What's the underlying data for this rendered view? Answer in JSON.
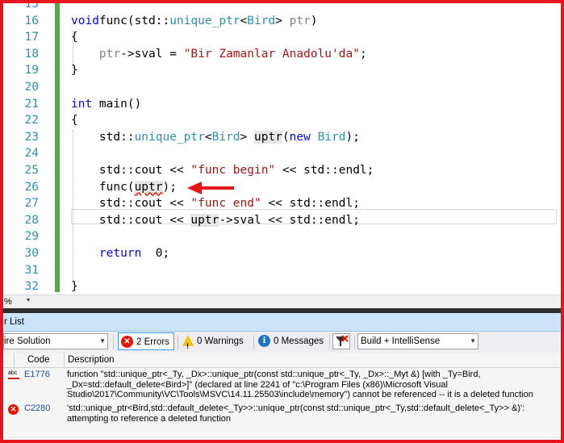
{
  "editor": {
    "lines": [
      {
        "num": "15",
        "tokens": []
      },
      {
        "num": "16",
        "tokens": [
          [
            "kw",
            "void"
          ],
          [
            "",
            "func(std::"
          ],
          [
            "ty",
            "unique_ptr"
          ],
          [
            "",
            "<"
          ],
          [
            "ty",
            "Bird"
          ],
          [
            "",
            "> "
          ],
          [
            "vr",
            "ptr"
          ],
          [
            "",
            ")"
          ]
        ]
      },
      {
        "num": "17",
        "tokens": [
          [
            "",
            "{"
          ]
        ]
      },
      {
        "num": "18",
        "tokens": [
          [
            "",
            "    "
          ],
          [
            "vr",
            "ptr"
          ],
          [
            "",
            "->sval = "
          ],
          [
            "st",
            "\"Bir Zamanlar Anadolu'da\""
          ],
          [
            "",
            ";"
          ]
        ]
      },
      {
        "num": "19",
        "tokens": [
          [
            "",
            "}"
          ]
        ]
      },
      {
        "num": "20",
        "tokens": []
      },
      {
        "num": "21",
        "tokens": [
          [
            "kw",
            "int"
          ],
          [
            "",
            " main()"
          ]
        ]
      },
      {
        "num": "22",
        "tokens": [
          [
            "",
            "{"
          ]
        ]
      },
      {
        "num": "23",
        "tokens": [
          [
            "",
            "    std::"
          ],
          [
            "ty",
            "unique_ptr"
          ],
          [
            "",
            "<"
          ],
          [
            "ty",
            "Bird"
          ],
          [
            "",
            "> "
          ],
          [
            "hl",
            "uptr"
          ],
          [
            "",
            "("
          ],
          [
            "kw",
            "new"
          ],
          [
            "",
            " "
          ],
          [
            "ty",
            "Bird"
          ],
          [
            "",
            ");"
          ]
        ]
      },
      {
        "num": "24",
        "tokens": []
      },
      {
        "num": "25",
        "tokens": [
          [
            "",
            "    std::cout << "
          ],
          [
            "st",
            "\"func begin\""
          ],
          [
            "",
            " << std::endl;"
          ]
        ]
      },
      {
        "num": "26",
        "tokens": [
          [
            "",
            "    func("
          ],
          [
            "hlsq",
            "uptr"
          ],
          [
            "",
            ");"
          ]
        ]
      },
      {
        "num": "27",
        "tokens": [
          [
            "",
            "    std::cout << "
          ],
          [
            "st",
            "\"func end\""
          ],
          [
            "",
            " << std::endl;"
          ]
        ]
      },
      {
        "num": "28",
        "tokens": [
          [
            "",
            "    std::cout << "
          ],
          [
            "hl",
            "uptr"
          ],
          [
            "",
            "->sval << std::endl;"
          ]
        ]
      },
      {
        "num": "29",
        "tokens": []
      },
      {
        "num": "30",
        "tokens": [
          [
            "",
            "    "
          ],
          [
            "kw",
            "return"
          ],
          [
            "",
            "  0;"
          ]
        ]
      },
      {
        "num": "31",
        "tokens": []
      },
      {
        "num": "32",
        "tokens": [
          [
            "",
            "}"
          ]
        ]
      }
    ]
  },
  "zoom": {
    "value": "%"
  },
  "error_list": {
    "title": "r List",
    "scope": "ire Solution",
    "errors_label": "2 Errors",
    "warnings_label": "0 Warnings",
    "messages_label": "0 Messages",
    "build_filter": "Build + IntelliSense",
    "columns": {
      "code": "Code",
      "description": "Description"
    },
    "rows": [
      {
        "icon": "intellisense-error-icon",
        "icon_text": "abc",
        "code": "E1776",
        "description": "function \"std::unique_ptr<_Ty, _Dx>::unique_ptr(const std::unique_ptr<_Ty, _Dx>::_Myt &) [with _Ty=Bird, _Dx=std::default_delete<Bird>]\" (declared at line 2241 of \"c:\\Program Files (x86)\\Microsoft Visual Studio\\2017\\Community\\VC\\Tools\\MSVC\\14.11.25503\\include\\memory\") cannot be referenced -- it is a deleted function"
      },
      {
        "icon": "build-error-icon",
        "icon_text": "",
        "code": "C2280",
        "description": "'std::unique_ptr<Bird,std::default_delete<_Ty>>::unique_ptr(const std::unique_ptr<_Ty,std::default_delete<_Ty>> &)': attempting to reference a deleted function"
      }
    ]
  },
  "colors": {
    "border": "#e8141b",
    "keyword": "#0000ff",
    "type": "#2b91af",
    "string": "#a31515",
    "error": "#e51400",
    "change_bar": "#57a64a"
  }
}
